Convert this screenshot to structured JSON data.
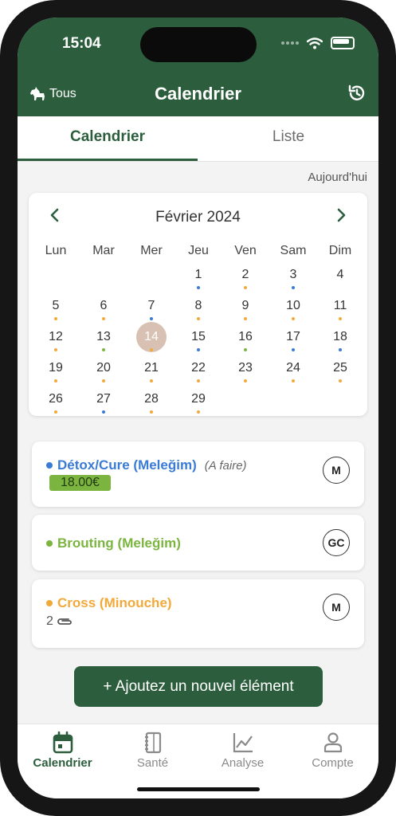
{
  "status_bar": {
    "time": "15:04"
  },
  "header": {
    "left_label": "Tous",
    "title": "Calendrier"
  },
  "tabs": [
    {
      "label": "Calendrier"
    },
    {
      "label": "Liste"
    }
  ],
  "today_link": "Aujourd'hui",
  "calendar": {
    "month": "Février 2024",
    "weekdays": [
      "Lun",
      "Mar",
      "Mer",
      "Jeu",
      "Ven",
      "Sam",
      "Dim"
    ],
    "selected_day": "14",
    "dot_colors": {
      "blue": "#3a7bd5",
      "orange": "#f2a93b",
      "green": "#7bb53f"
    },
    "days": [
      {
        "n": "1",
        "col": 3,
        "row": 0,
        "dot": "blue"
      },
      {
        "n": "2",
        "col": 4,
        "row": 0,
        "dot": "orange"
      },
      {
        "n": "3",
        "col": 5,
        "row": 0,
        "dot": "blue"
      },
      {
        "n": "4",
        "col": 6,
        "row": 0,
        "dot": ""
      },
      {
        "n": "5",
        "col": 0,
        "row": 1,
        "dot": "orange"
      },
      {
        "n": "6",
        "col": 1,
        "row": 1,
        "dot": "orange"
      },
      {
        "n": "7",
        "col": 2,
        "row": 1,
        "dot": "blue"
      },
      {
        "n": "8",
        "col": 3,
        "row": 1,
        "dot": "orange"
      },
      {
        "n": "9",
        "col": 4,
        "row": 1,
        "dot": "orange"
      },
      {
        "n": "10",
        "col": 5,
        "row": 1,
        "dot": "orange"
      },
      {
        "n": "11",
        "col": 6,
        "row": 1,
        "dot": "orange"
      },
      {
        "n": "12",
        "col": 0,
        "row": 2,
        "dot": "orange"
      },
      {
        "n": "13",
        "col": 1,
        "row": 2,
        "dot": "green"
      },
      {
        "n": "14",
        "col": 2,
        "row": 2,
        "dot": "orange"
      },
      {
        "n": "15",
        "col": 3,
        "row": 2,
        "dot": "blue"
      },
      {
        "n": "16",
        "col": 4,
        "row": 2,
        "dot": "green"
      },
      {
        "n": "17",
        "col": 5,
        "row": 2,
        "dot": "blue"
      },
      {
        "n": "18",
        "col": 6,
        "row": 2,
        "dot": "blue"
      },
      {
        "n": "19",
        "col": 0,
        "row": 3,
        "dot": "orange"
      },
      {
        "n": "20",
        "col": 1,
        "row": 3,
        "dot": "orange"
      },
      {
        "n": "21",
        "col": 2,
        "row": 3,
        "dot": "orange"
      },
      {
        "n": "22",
        "col": 3,
        "row": 3,
        "dot": "orange"
      },
      {
        "n": "23",
        "col": 4,
        "row": 3,
        "dot": "orange"
      },
      {
        "n": "24",
        "col": 5,
        "row": 3,
        "dot": "orange"
      },
      {
        "n": "25",
        "col": 6,
        "row": 3,
        "dot": "orange"
      },
      {
        "n": "26",
        "col": 0,
        "row": 4,
        "dot": "orange"
      },
      {
        "n": "27",
        "col": 1,
        "row": 4,
        "dot": "blue"
      },
      {
        "n": "28",
        "col": 2,
        "row": 4,
        "dot": "orange"
      },
      {
        "n": "29",
        "col": 3,
        "row": 4,
        "dot": "orange"
      }
    ]
  },
  "events": [
    {
      "title": "Détox/Cure (Meleğim)",
      "status": "(A faire)",
      "price": "18.00€",
      "avatar": "M",
      "color": "#3a7bd5"
    },
    {
      "title": "Brouting (Meleğim)",
      "avatar": "GC",
      "color": "#7bb53f"
    },
    {
      "title": "Cross (Minouche)",
      "attachments": "2",
      "avatar": "M",
      "color": "#f2a93b"
    }
  ],
  "add_button": "+ Ajoutez un nouvel élément",
  "bottom_nav": [
    {
      "label": "Calendrier",
      "icon": "calendar-icon"
    },
    {
      "label": "Santé",
      "icon": "notebook-icon"
    },
    {
      "label": "Analyse",
      "icon": "chart-icon"
    },
    {
      "label": "Compte",
      "icon": "user-icon"
    }
  ],
  "colors": {
    "brand": "#2c5e3d",
    "accent_price": "#7bb53f"
  }
}
